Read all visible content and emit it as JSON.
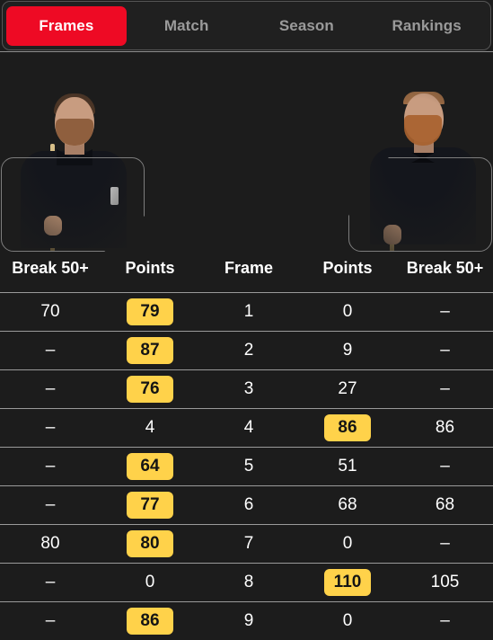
{
  "tabs": [
    {
      "label": "Frames",
      "active": true
    },
    {
      "label": "Match",
      "active": false
    },
    {
      "label": "Season",
      "active": false
    },
    {
      "label": "Rankings",
      "active": false
    }
  ],
  "players": [
    {
      "side": "left",
      "photo_alt": "player-photo-left"
    },
    {
      "side": "right",
      "photo_alt": "player-photo-right"
    }
  ],
  "table": {
    "headers": [
      "Break 50+",
      "Points",
      "Frame",
      "Points",
      "Break 50+"
    ],
    "rows": [
      {
        "break_left": "70",
        "points_left": "79",
        "frame": "1",
        "points_right": "0",
        "break_right": "–",
        "winner": "left"
      },
      {
        "break_left": "–",
        "points_left": "87",
        "frame": "2",
        "points_right": "9",
        "break_right": "–",
        "winner": "left"
      },
      {
        "break_left": "–",
        "points_left": "76",
        "frame": "3",
        "points_right": "27",
        "break_right": "–",
        "winner": "left"
      },
      {
        "break_left": "–",
        "points_left": "4",
        "frame": "4",
        "points_right": "86",
        "break_right": "86",
        "winner": "right"
      },
      {
        "break_left": "–",
        "points_left": "64",
        "frame": "5",
        "points_right": "51",
        "break_right": "–",
        "winner": "left"
      },
      {
        "break_left": "–",
        "points_left": "77",
        "frame": "6",
        "points_right": "68",
        "break_right": "68",
        "winner": "left"
      },
      {
        "break_left": "80",
        "points_left": "80",
        "frame": "7",
        "points_right": "0",
        "break_right": "–",
        "winner": "left"
      },
      {
        "break_left": "–",
        "points_left": "0",
        "frame": "8",
        "points_right": "110",
        "break_right": "105",
        "winner": "right"
      },
      {
        "break_left": "–",
        "points_left": "86",
        "frame": "9",
        "points_right": "0",
        "break_right": "–",
        "winner": "left"
      }
    ]
  },
  "colors": {
    "background": "#1c1c1c",
    "tab_active": "#ee0a24",
    "tab_inactive_text": "#9a9a9a",
    "winner_badge": "#ffd24a",
    "badge_text": "#141414",
    "row_divider": "#9a9a9a",
    "text": "#ffffff"
  }
}
